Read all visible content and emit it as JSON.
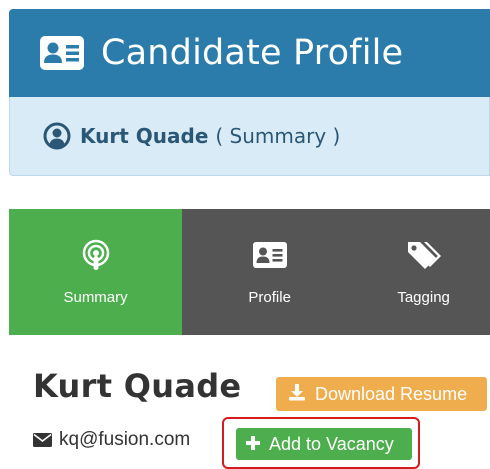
{
  "header": {
    "title": "Candidate Profile",
    "icon": "id-card-icon",
    "color": "#2b7cab"
  },
  "subheader": {
    "name": "Kurt Quade",
    "context": "( Summary )",
    "icon": "user-circle-icon",
    "color": "#d9ebf6"
  },
  "tabs": [
    {
      "label": "Summary",
      "icon": "podcast-icon",
      "active": true
    },
    {
      "label": "Profile",
      "icon": "id-card-icon",
      "active": false
    },
    {
      "label": "Tagging",
      "icon": "tags-icon",
      "active": false
    }
  ],
  "candidate": {
    "name": "Kurt Quade",
    "email": "kq@fusion.com",
    "email_icon": "envelope-icon"
  },
  "actions": {
    "download_label": "Download Resume",
    "download_icon": "download-icon",
    "download_color": "#f0ad4e",
    "vacancy_label": "Add to Vacancy",
    "vacancy_icon": "plus-icon",
    "vacancy_color": "#4cae4c",
    "highlight_color": "#d61b1b"
  },
  "colors": {
    "tab_active": "#4cae4c",
    "tab_bar": "#555555"
  }
}
